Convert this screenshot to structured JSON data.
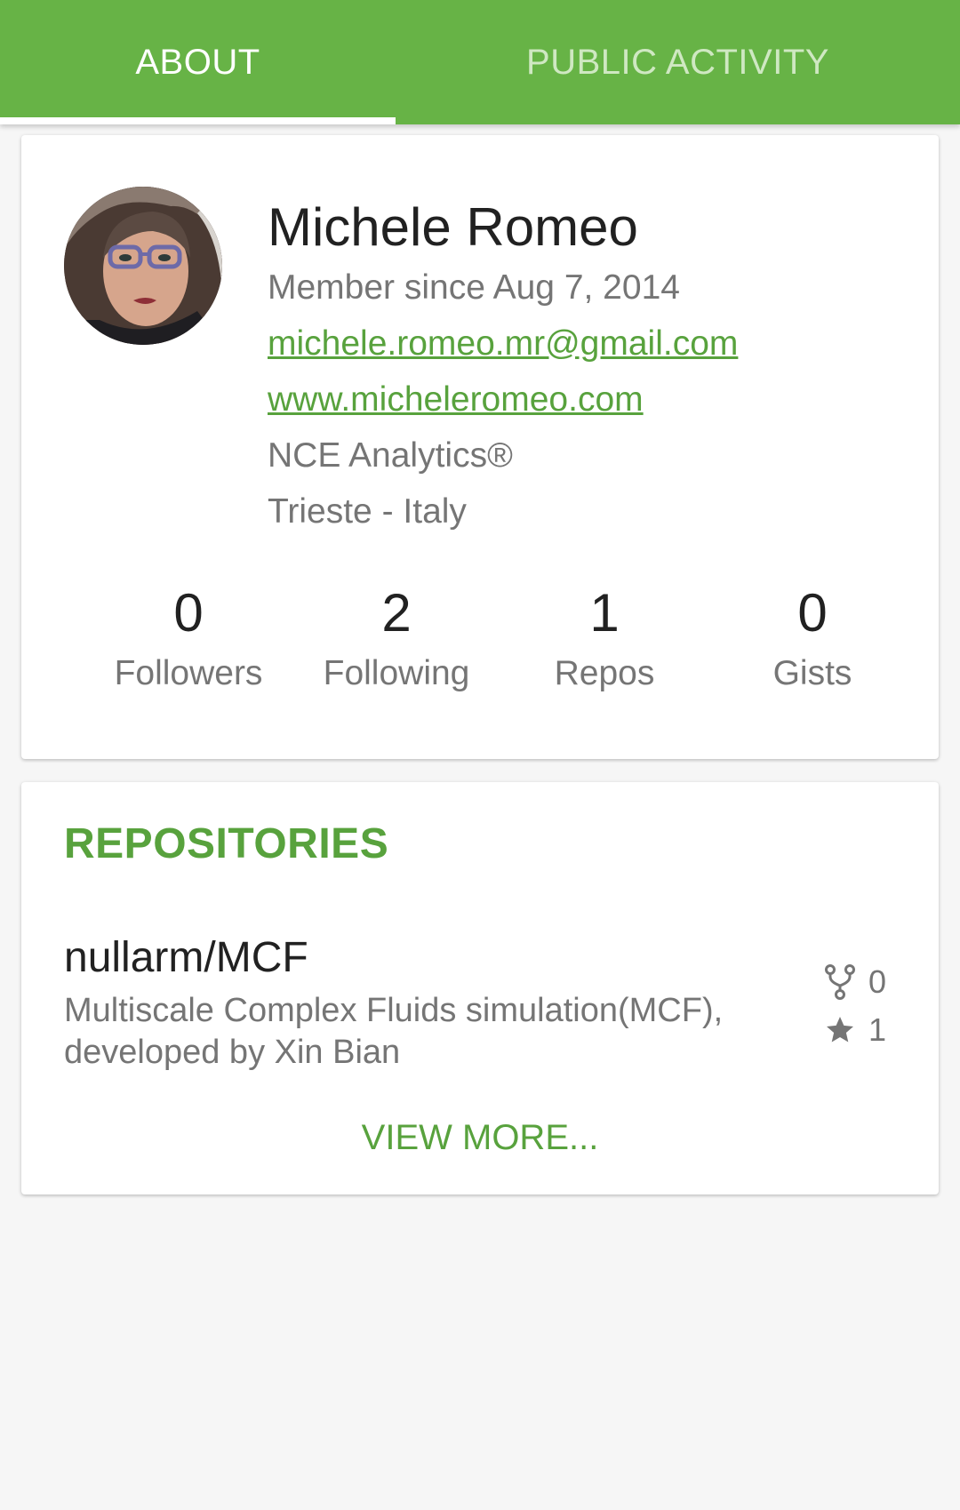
{
  "tabs": [
    {
      "label": "ABOUT",
      "selected": true
    },
    {
      "label": "PUBLIC ACTIVITY",
      "selected": false
    }
  ],
  "profile": {
    "name": "Michele Romeo",
    "member_since": "Member since Aug 7, 2014",
    "email": "michele.romeo.mr@gmail.com",
    "website": "www.micheleromeo.com",
    "company": "NCE Analytics®",
    "location": "Trieste - Italy",
    "avatar_icon": "user-avatar-photo"
  },
  "stats": [
    {
      "value": "0",
      "label": "Followers"
    },
    {
      "value": "2",
      "label": "Following"
    },
    {
      "value": "1",
      "label": "Repos"
    },
    {
      "value": "0",
      "label": "Gists"
    }
  ],
  "repositories": {
    "title": "REPOSITORIES",
    "items": [
      {
        "name": "nullarm/MCF",
        "description": "Multiscale Complex Fluids simulation(MCF), developed by Xin Bian",
        "forks": "0",
        "stars": "1",
        "fork_icon": "fork-icon",
        "star_icon": "star-icon"
      }
    ],
    "view_more_label": "VIEW MORE..."
  },
  "colors": {
    "accent": "#67b346",
    "link": "#58a23d",
    "background": "#f6f6f6"
  }
}
